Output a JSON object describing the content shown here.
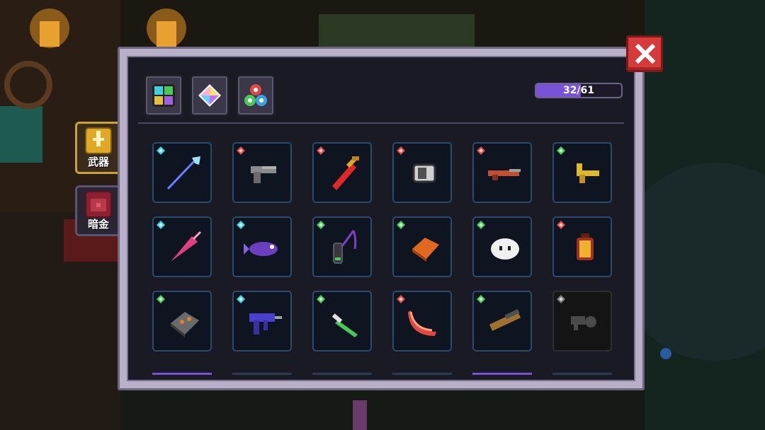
{
  "colors": {
    "accent_purple": "#7a52d8",
    "close_red": "#d63a3a",
    "slot_border": "#2a4a6e",
    "gem_cyan": "#3fd0e0",
    "gem_red": "#e04848",
    "gem_green": "#4cc85a",
    "gem_gray": "#7a7a7a"
  },
  "side_tabs": [
    {
      "label": "武器",
      "icon": "weapon-icon"
    },
    {
      "label": "暗金",
      "icon": "chest-icon"
    }
  ],
  "top_tabs": [
    {
      "icon": "grid-tiles-icon"
    },
    {
      "icon": "diamond-gem-icon"
    },
    {
      "icon": "orbs-icon"
    }
  ],
  "counter": {
    "current": 32,
    "total": 61,
    "text": "32/61"
  },
  "grid": {
    "rows": [
      [
        {
          "icon": "spear-icon",
          "gem": "cyan"
        },
        {
          "icon": "pistol-icon",
          "gem": "red"
        },
        {
          "icon": "red-sword-icon",
          "gem": "red"
        },
        {
          "icon": "gauntlet-icon",
          "gem": "red"
        },
        {
          "icon": "rifle-icon",
          "gem": "red"
        },
        {
          "icon": "gold-key-gun-icon",
          "gem": "green"
        }
      ],
      [
        {
          "icon": "pink-lance-icon",
          "gem": "cyan"
        },
        {
          "icon": "fish-gun-icon",
          "gem": "cyan"
        },
        {
          "icon": "whip-icon",
          "gem": "green"
        },
        {
          "icon": "brick-icon",
          "gem": "green"
        },
        {
          "icon": "dumpling-icon",
          "gem": "green"
        },
        {
          "icon": "lantern-icon",
          "gem": "red"
        }
      ],
      [
        {
          "icon": "stone-block-icon",
          "gem": "green"
        },
        {
          "icon": "smg-icon",
          "gem": "cyan"
        },
        {
          "icon": "green-dagger-icon",
          "gem": "green"
        },
        {
          "icon": "boomerang-icon",
          "gem": "red"
        },
        {
          "icon": "shotgun-icon",
          "gem": "green"
        },
        {
          "icon": "locked-weapon-icon",
          "gem": "gray",
          "locked": true
        }
      ]
    ]
  }
}
